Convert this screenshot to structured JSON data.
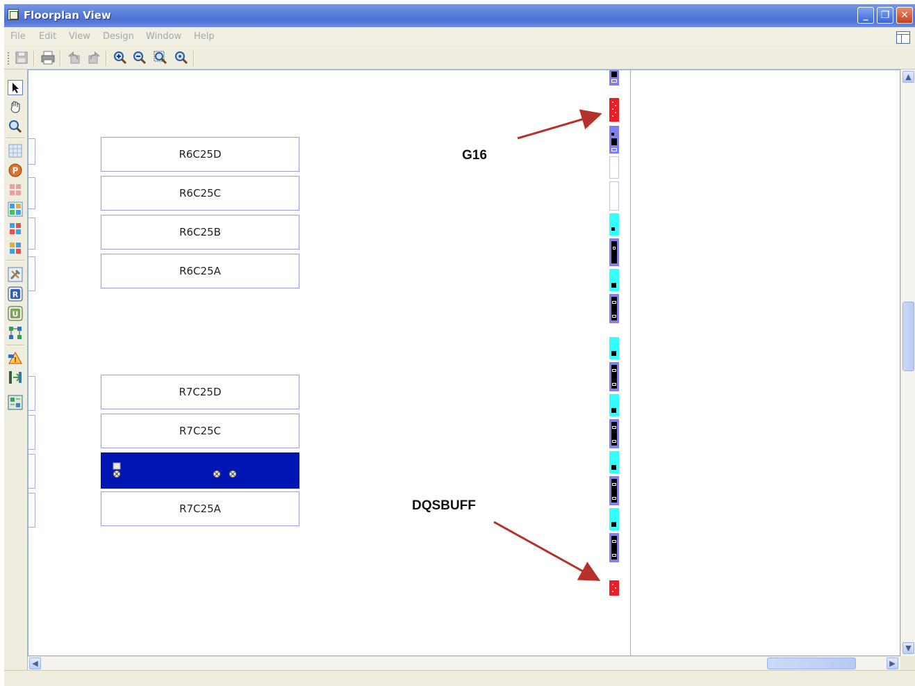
{
  "window": {
    "title": "Floorplan View",
    "controls": {
      "minimize": "_",
      "restore": "❐",
      "close": "✕"
    }
  },
  "menu": {
    "items": [
      "File",
      "Edit",
      "View",
      "Design",
      "Window",
      "Help"
    ]
  },
  "toolbar": {
    "icons": [
      "save-icon",
      "print-icon",
      "undo-icon",
      "redo-icon",
      "zoom-in-icon",
      "zoom-out-icon",
      "zoom-fit-icon",
      "zoom-area-icon"
    ]
  },
  "left_toolbar": {
    "icons": [
      "select-arrow-icon",
      "pan-hand-icon",
      "zoom-icon",
      "grid-icon",
      "p-icon",
      "group-icon",
      "layout-icon",
      "layout2-icon",
      "layout3-icon",
      "tools-icon",
      "r-icon",
      "u-icon",
      "route-icon",
      "warning-icon",
      "import-icon",
      "map-icon"
    ]
  },
  "canvas": {
    "slices_top": [
      "R6C25D",
      "R6C25C",
      "R6C25B",
      "R6C25A"
    ],
    "slices_bottom": [
      "R7C25D",
      "R7C25C",
      "",
      "R7C25A"
    ],
    "selected_slice_index": 2,
    "annotations": {
      "g16": "G16",
      "dqsbuff": "DQSBUFF"
    }
  },
  "colors": {
    "selected_slice": "#0016b4",
    "highlight_pio": "#ee1c24",
    "pio_cyan": "#33ffff",
    "pio_purple": "#8080f0",
    "arrow": "#b5312a"
  }
}
